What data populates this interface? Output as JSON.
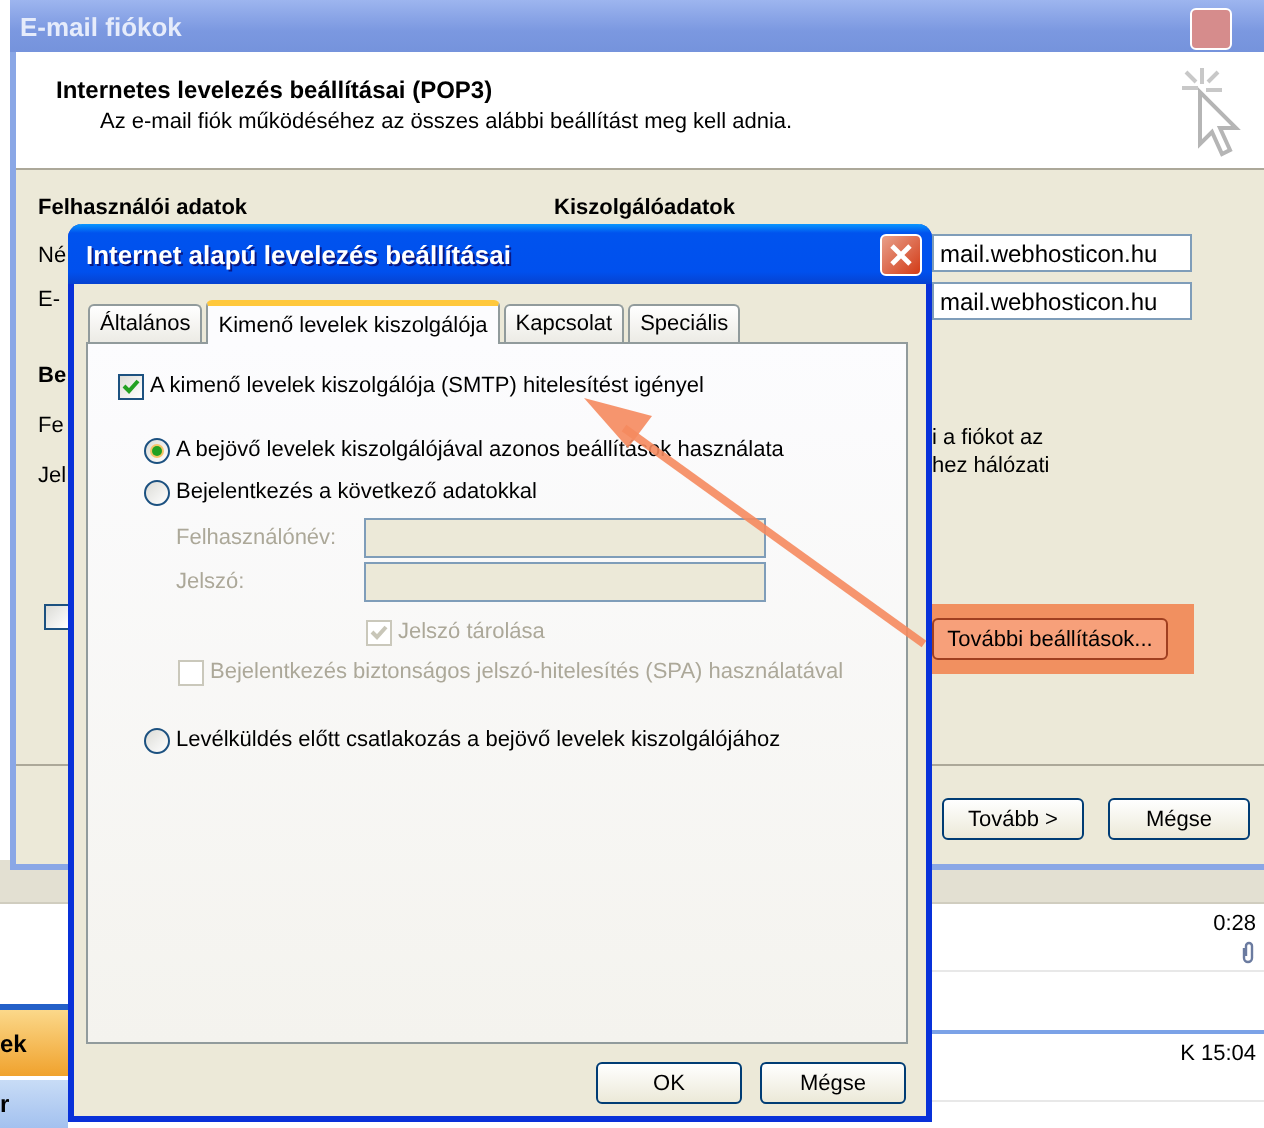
{
  "background_app": {
    "taskbar_items": [
      {
        "label": "ek",
        "selected": true
      },
      {
        "label": "r",
        "selected": false
      }
    ],
    "messages": [
      {
        "time": "0:28",
        "attachment": true
      },
      {
        "time": "K 15:04",
        "attachment": false
      }
    ]
  },
  "wizard": {
    "title": "E-mail fiókok",
    "heading": "Internetes levelezés beállításai (POP3)",
    "subheading": "Az e-mail fiók működéséhez az összes alábbi beállítást meg kell adnia.",
    "user_section": {
      "title": "Felhasználói adatok",
      "labels": [
        "Né",
        "E-"
      ]
    },
    "server_section": {
      "title": "Kiszolgálóadatok",
      "fields": [
        "mail.webhosticon.hu",
        "mail.webhosticon.hu"
      ]
    },
    "logon_section": {
      "title": "Be",
      "labels": [
        "Fe",
        "Jel"
      ],
      "checked": false
    },
    "note_lines": [
      "i a fiókot az",
      "hez hálózati"
    ],
    "more_settings": {
      "label": "További beállítások...",
      "highlighted": true
    },
    "buttons": [
      "Tovább >",
      "Mégse"
    ]
  },
  "dialog": {
    "title": "Internet alapú levelezés beállításai",
    "tabs": [
      {
        "label": "Általános",
        "selected": false
      },
      {
        "label": "Kimenő levelek kiszolgálója",
        "selected": true
      },
      {
        "label": "Kapcsolat",
        "selected": false
      },
      {
        "label": "Speciális",
        "selected": false
      }
    ],
    "smtp_auth": {
      "label": "A kimenő levelek kiszolgálója (SMTP) hitelesítést igényel",
      "checked": true
    },
    "auth_options": [
      {
        "label": "A bejövő levelek kiszolgálójával azonos beállítások használata",
        "selected": true
      },
      {
        "label": "Bejelentkezés a következő adatokkal",
        "selected": false
      }
    ],
    "fields": [
      {
        "label": "Felhasználónév:",
        "disabled": true
      },
      {
        "label": "Jelszó:",
        "disabled": true
      }
    ],
    "remember_password": {
      "label": "Jelszó tárolása",
      "checked": true,
      "disabled": true
    },
    "spa": {
      "label": "Bejelentkezés biztonságos jelszó-hitelesítés (SPA) használatával",
      "checked": false,
      "disabled": true
    },
    "connect_before": {
      "label": "Levélküldés előtt csatlakozás a bejövő levelek kiszolgálójához",
      "selected": false
    },
    "buttons": [
      "OK",
      "Mégse"
    ]
  }
}
